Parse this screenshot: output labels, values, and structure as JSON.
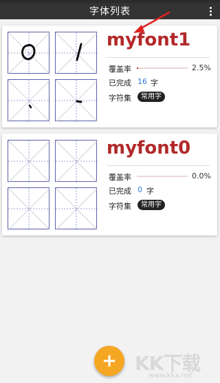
{
  "appbar": {
    "title": "字体列表",
    "menu_icon": "more-vert-icon"
  },
  "fonts": [
    {
      "name": "myfont1",
      "coverage_label": "覆盖率",
      "coverage_text": "2.5%",
      "coverage_fraction": 0.025,
      "completed_label": "已完成",
      "completed_count": "16",
      "completed_unit": "字",
      "charset_label": "字符集",
      "charset_value": "常用字"
    },
    {
      "name": "myfont0",
      "coverage_label": "覆盖率",
      "coverage_text": "0.0%",
      "coverage_fraction": 0.0,
      "completed_label": "已完成",
      "completed_count": "0",
      "completed_unit": "字",
      "charset_label": "字符集",
      "charset_value": "常用字"
    }
  ],
  "fab": {
    "label": "+",
    "icon": "add-icon"
  },
  "colors": {
    "appbar": "#333333",
    "font_name": "#b2292a",
    "count": "#2f7ad6",
    "fab": "#f5a623",
    "grid": "#5b5fa6"
  },
  "watermark": {
    "text": "KK下载",
    "url": "www.kkx.net"
  }
}
